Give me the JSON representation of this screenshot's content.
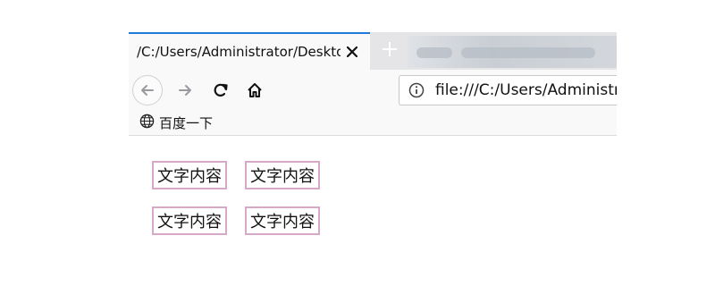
{
  "browser": {
    "tab": {
      "title": "/C:/Users/Administrator/Desktop",
      "close_icon": "close-icon",
      "new_tab_icon": "plus-icon"
    },
    "nav": {
      "back_icon": "arrow-left-icon",
      "forward_icon": "arrow-right-icon",
      "reload_icon": "reload-icon",
      "home_icon": "home-icon",
      "url": "file:///C:/Users/Administrator/Desktop/",
      "info_icon": "info-icon"
    },
    "bookmarks": [
      {
        "label": "百度一下",
        "icon": "globe-icon"
      }
    ]
  },
  "content": {
    "boxes": [
      "文字内容",
      "文字内容",
      "文字内容",
      "文字内容"
    ]
  },
  "colors": {
    "box_border": "#d8a8c8",
    "tab_accent": "#1e7ad6"
  }
}
